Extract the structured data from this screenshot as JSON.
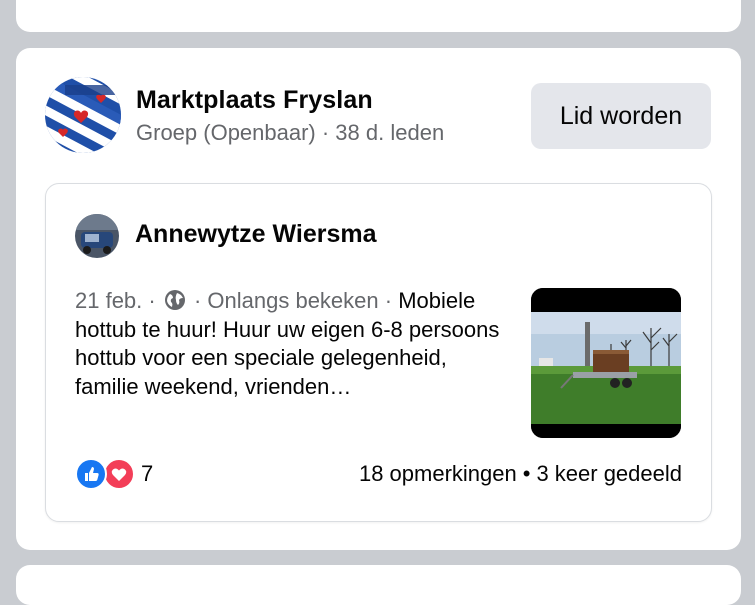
{
  "group": {
    "name": "Marktplaats Fryslan",
    "meta": "Groep (Openbaar) · 38 d. leden",
    "join_label": "Lid worden"
  },
  "post": {
    "author": "Annewytze Wiersma",
    "date": "21 feb. ·",
    "recently_viewed": "· Onlangs bekeken ·",
    "text": "Mobiele hottub te huur! Huur uw eigen 6-8 persoons hottub voor een speciale gelegenheid, familie weekend, vrienden…",
    "reaction_count": "7",
    "comments": "18 opmerkingen",
    "separator": "•",
    "shares": "3 keer gedeeld"
  },
  "icons": {
    "privacy": "globe-icon",
    "like": "like-reaction-icon",
    "love": "love-reaction-icon"
  },
  "colors": {
    "like_blue": "#1877f2",
    "love_red": "#f33e58",
    "button_bg": "#e4e6eb",
    "secondary_text": "#65676b"
  }
}
